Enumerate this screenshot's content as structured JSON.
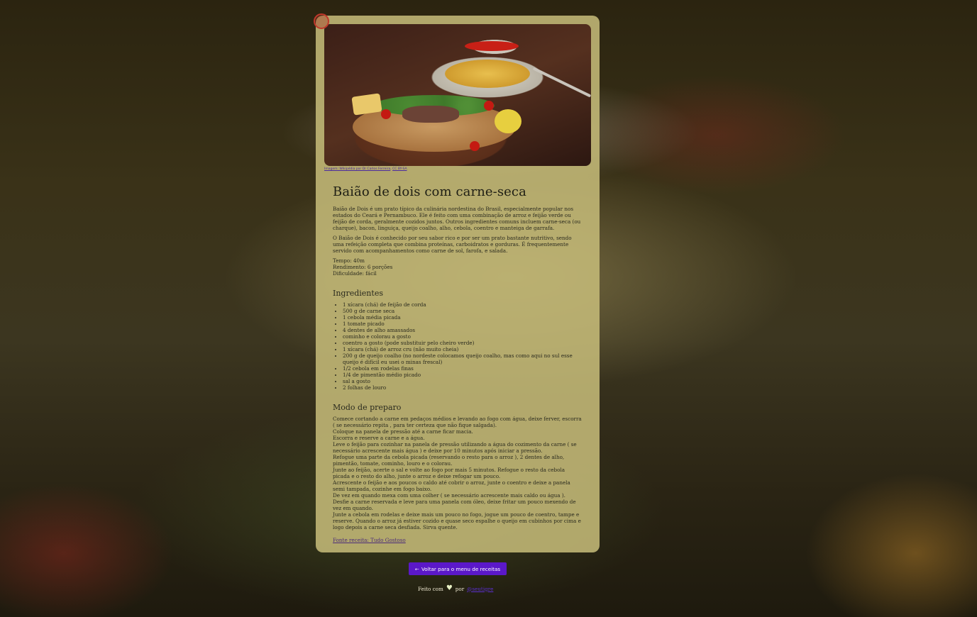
{
  "recipe": {
    "image_credit": {
      "prefix": "Imagem: Wikipédia por Dr Carlos Ferreira",
      "license": "CC BY-SA"
    },
    "title": "Baião de dois com carne-seca",
    "intro": [
      "Baião de Dois é um prato típico da culinária nordestina do Brasil, especialmente popular nos estados do Ceará e Pernambuco. Ele é feito com uma combinação de arroz e feijão verde ou feijão de corda, geralmente cozidos juntos. Outros ingredientes comuns incluem carne-seca (ou charque), bacon, linguiça, queijo coalho, alho, cebola, coentro e manteiga de garrafa.",
      "O Baião de Dois é conhecido por seu sabor rico e por ser um prato bastante nutritivo, sendo uma refeição completa que combina proteínas, carboidratos e gorduras. É frequentemente servido com acompanhamentos como carne de sol, farofa, e salada."
    ],
    "meta": {
      "time": "Tempo: 40m",
      "yield": "Rendimento: 6 porções",
      "difficulty": "Dificuldade: fácil"
    },
    "ingredients_title": "Ingredientes",
    "ingredients": [
      "1 xícara (chá) de feijão de corda",
      "500 g de carne seca",
      "1 cebola média picada",
      "1 tomate picado",
      "4 dentes de alho amassados",
      "cominho e colorau a gosto",
      "coentro a gosto (pode substituir pelo cheiro verde)",
      "1 xícara (chá) de arroz cru (não muito cheia)",
      "200 g de queijo coalho (no nordeste colocamos queijo coalho, mas como aqui no sul esse queijo é difícil eu usei o minas frescal)",
      "1/2 cebola em rodelas finas",
      "1/4 de pimentão médio picado",
      "sal a gosto",
      "2 folhas de louro"
    ],
    "steps_title": "Modo de preparo",
    "steps": [
      "Comece cortando a carne em pedaços médios e levando ao fogo com água, deixe ferver, escorra ( se necessário repita , para ter certeza que não fique salgada).",
      "Coloque na panela de pressão até a carne ficar macia.",
      "Escorra e reserve a carne e a água.",
      "Leve o feijão para cozinhar na panela de pressão utilizando a água do cozimento da carne ( se necessário acrescente mais água ) e deixe por 10 minutos após iniciar a pressão.",
      "Refogue uma parte da cebola picada (reservando o resto para o arroz ), 2 dentes de alho, pimentão, tomate, cominho, louro e o colorau.",
      "Junte ao feijão, acerte o sal e volte ao fogo por mais 5 minutos. Refogue o resto da cebola picada e o resto do alho, junte o arroz e deixe refogar um pouco.",
      "Acrescente o feijão e aos poucos o caldo até cobrir o arroz, junte o coentro e deixe a panela semi tampada, cozinhe em fogo baixo.",
      "De vez em quando mexa com uma colher ( se necessário acrescente mais caldo ou água ). Desfie a carne reservada e leve para uma panela com óleo, deixe fritar um pouco mexendo de vez em quando.",
      "Junte a cebola em rodelas e deixe mais um pouco no fogo, jogue um pouco de coentro, tampe e reserve. Quando o arroz já estiver cozido e quase seco espalhe o queijo em cubinhos por cima e logo depois a carne seca desfiada. Sirva quente."
    ],
    "source_link": "Fonte receita: Tudo Gostoso"
  },
  "nav": {
    "back_label": "Voltar para o menu de receitas",
    "back_icon": "arrow-left-icon"
  },
  "footer": {
    "made_with": "Feito com",
    "heart_icon": "heart-icon",
    "by": "por",
    "author": "@seutigre"
  },
  "colors": {
    "card_bg": "#c4ba78",
    "button_bg": "#5b18c9",
    "link": "#4a2a7a"
  }
}
